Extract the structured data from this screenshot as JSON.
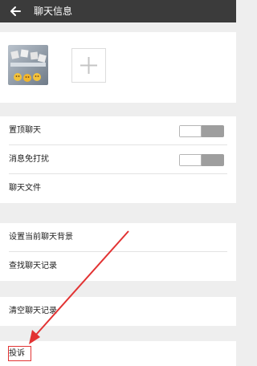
{
  "header": {
    "title": "聊天信息",
    "back_icon": "back-arrow-icon"
  },
  "members": {
    "add_icon": "plus-icon"
  },
  "settings_group_1": {
    "pin_chat_label": "置顶聊天",
    "pin_chat_on": false,
    "mute_label": "消息免打扰",
    "mute_on": false,
    "chat_files_label": "聊天文件"
  },
  "settings_group_2": {
    "background_label": "设置当前聊天背景",
    "search_history_label": "查找聊天记录"
  },
  "settings_group_3": {
    "clear_history_label": "清空聊天记录"
  },
  "settings_group_4": {
    "report_label": "投诉"
  },
  "colors": {
    "topbar": "#3b3b3b",
    "background": "#eeeeee",
    "annotation": "#e23333"
  }
}
